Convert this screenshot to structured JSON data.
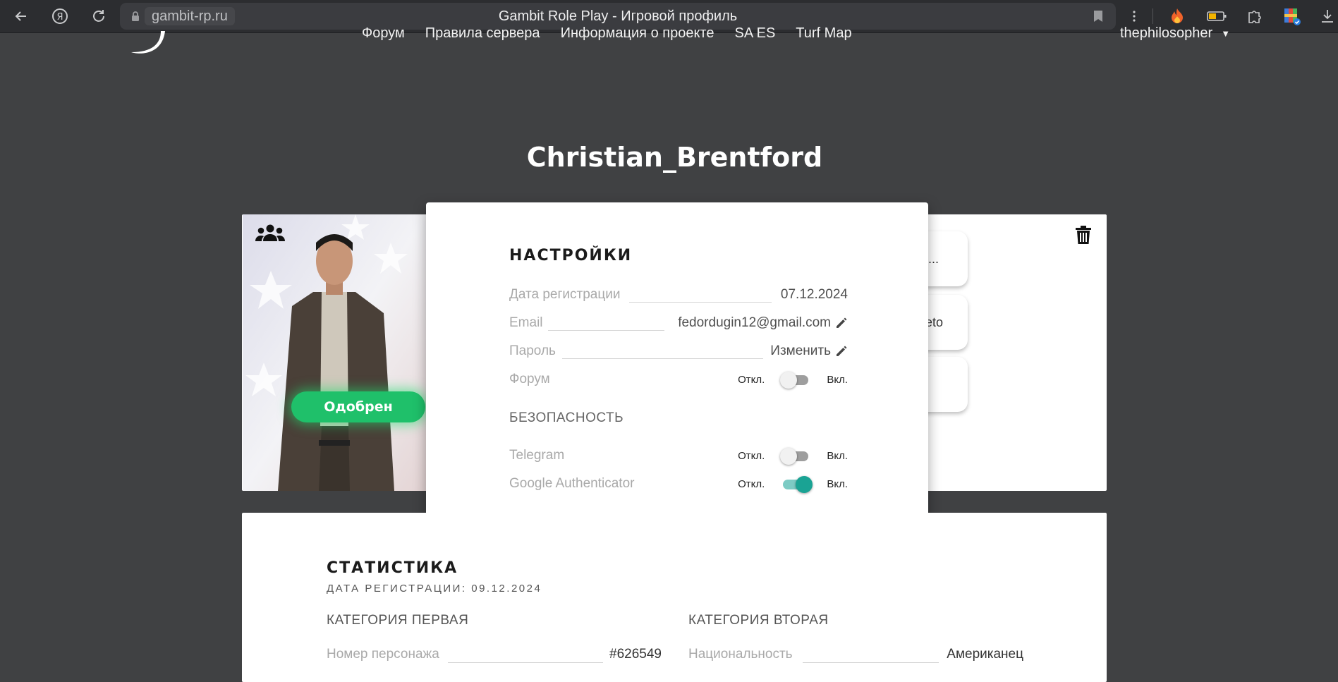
{
  "browser": {
    "domain": "gambit-rp.ru",
    "tab_title": "Gambit Role Play - Игровой профиль"
  },
  "nav": {
    "items": [
      "Форум",
      "Правила сервера",
      "Информация о проекте",
      "SA ES",
      "Turf Map"
    ],
    "user": "thephilosopher"
  },
  "profile": {
    "character_name": "Christian_Brentford",
    "status_label": "Одобрен",
    "side_tiles": [
      "l...",
      "eto",
      ""
    ]
  },
  "settings": {
    "title": "НАСТРОЙКИ",
    "registration_label": "Дата регистрации",
    "registration_value": "07.12.2024",
    "email_label": "Email",
    "email_value": "fedordugin12@gmail.com",
    "password_label": "Пароль",
    "password_action": "Изменить",
    "forum_label": "Форум",
    "forum_enabled": false,
    "security_title": "БЕЗОПАСНОСТЬ",
    "telegram_label": "Telegram",
    "telegram_enabled": false,
    "ga_label": "Google Authenticator",
    "ga_enabled": true,
    "off_label": "Откл.",
    "on_label": "Вкл."
  },
  "stats": {
    "title": "СТАТИСТИКА",
    "subtitle": "ДАТА РЕГИСТРАЦИИ: 09.12.2024",
    "category_one": "КАТЕГОРИЯ ПЕРВАЯ",
    "category_two": "КАТЕГОРИЯ ВТОРАЯ",
    "char_number_label": "Номер персонажа",
    "char_number_value": "#626549",
    "nationality_label": "Национальность",
    "nationality_value": "Американец"
  },
  "colors": {
    "page_bg": "#404143",
    "approved_green": "#1fc06a",
    "toggle_on": "#1aa394"
  }
}
